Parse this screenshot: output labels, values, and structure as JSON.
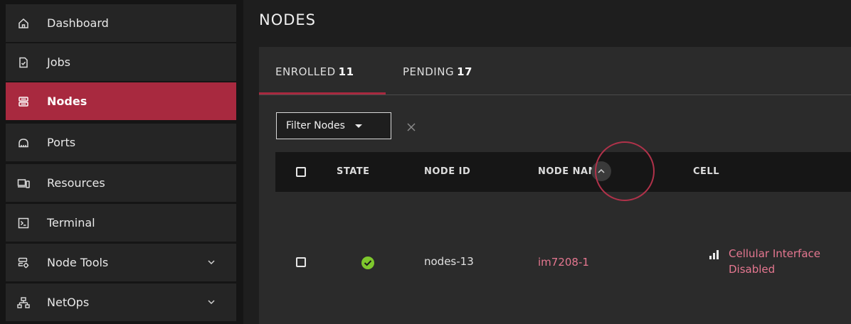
{
  "sidebar": {
    "items": [
      {
        "label": "Dashboard",
        "icon": "home-icon"
      },
      {
        "label": "Jobs",
        "icon": "jobs-icon"
      },
      {
        "label": "Nodes",
        "icon": "nodes-icon",
        "active": true
      },
      {
        "label": "Ports",
        "icon": "ports-icon"
      },
      {
        "label": "Resources",
        "icon": "resources-icon"
      },
      {
        "label": "Terminal",
        "icon": "terminal-icon"
      },
      {
        "label": "Node Tools",
        "icon": "node-tools-icon",
        "expandable": true
      },
      {
        "label": "NetOps",
        "icon": "netops-icon",
        "expandable": true
      }
    ]
  },
  "page": {
    "title": "NODES"
  },
  "tabs": [
    {
      "label": "ENROLLED",
      "count": "11",
      "active": true
    },
    {
      "label": "PENDING",
      "count": "17"
    }
  ],
  "filter": {
    "label": "Filter Nodes"
  },
  "table": {
    "columns": [
      "STATE",
      "NODE ID",
      "NODE NAME",
      "CELL"
    ],
    "rows": [
      {
        "state": "check-circle-icon",
        "node_id": "nodes-13",
        "node_name": "im7208-1",
        "cell": "Cellular Interface Disabled"
      }
    ]
  },
  "colors": {
    "accent": "#a8293f",
    "link": "#e57790",
    "ok": "#7ec82d"
  }
}
